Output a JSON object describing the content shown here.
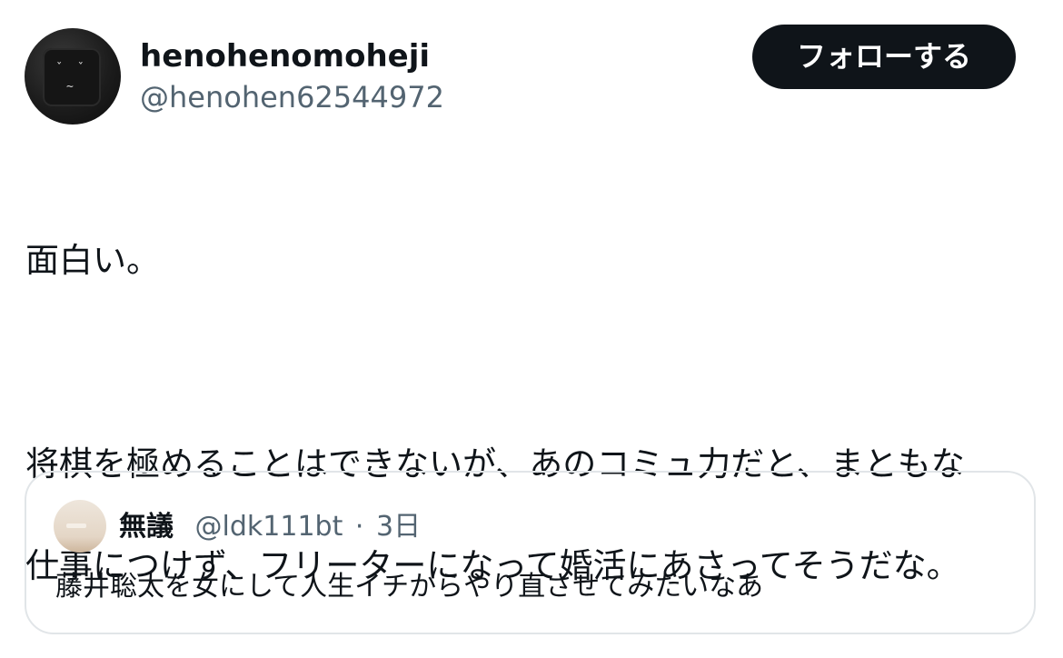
{
  "author": {
    "display_name": "henohenomoheji",
    "handle": "@henohen62544972",
    "avatar_icon": "keyboard-key-face-avatar"
  },
  "follow_button": {
    "label": "フォローする"
  },
  "tweet": {
    "lines": [
      "面白い。",
      "",
      "将棋を極めることはできないが、あのコミュ力だと、まともな",
      "仕事につけず、フリーターになって婚活にあさってそうだな。"
    ]
  },
  "quote": {
    "display_name": "無議",
    "handle": "@ldk111bt",
    "separator": "·",
    "time": "3日",
    "text": "藤井聡太を女にして人生イチからやり直させてみたいなあ"
  },
  "colors": {
    "text_primary": "#0f1419",
    "text_secondary": "#536471",
    "button_bg": "#0f1419",
    "border": "#e1e5e8"
  }
}
